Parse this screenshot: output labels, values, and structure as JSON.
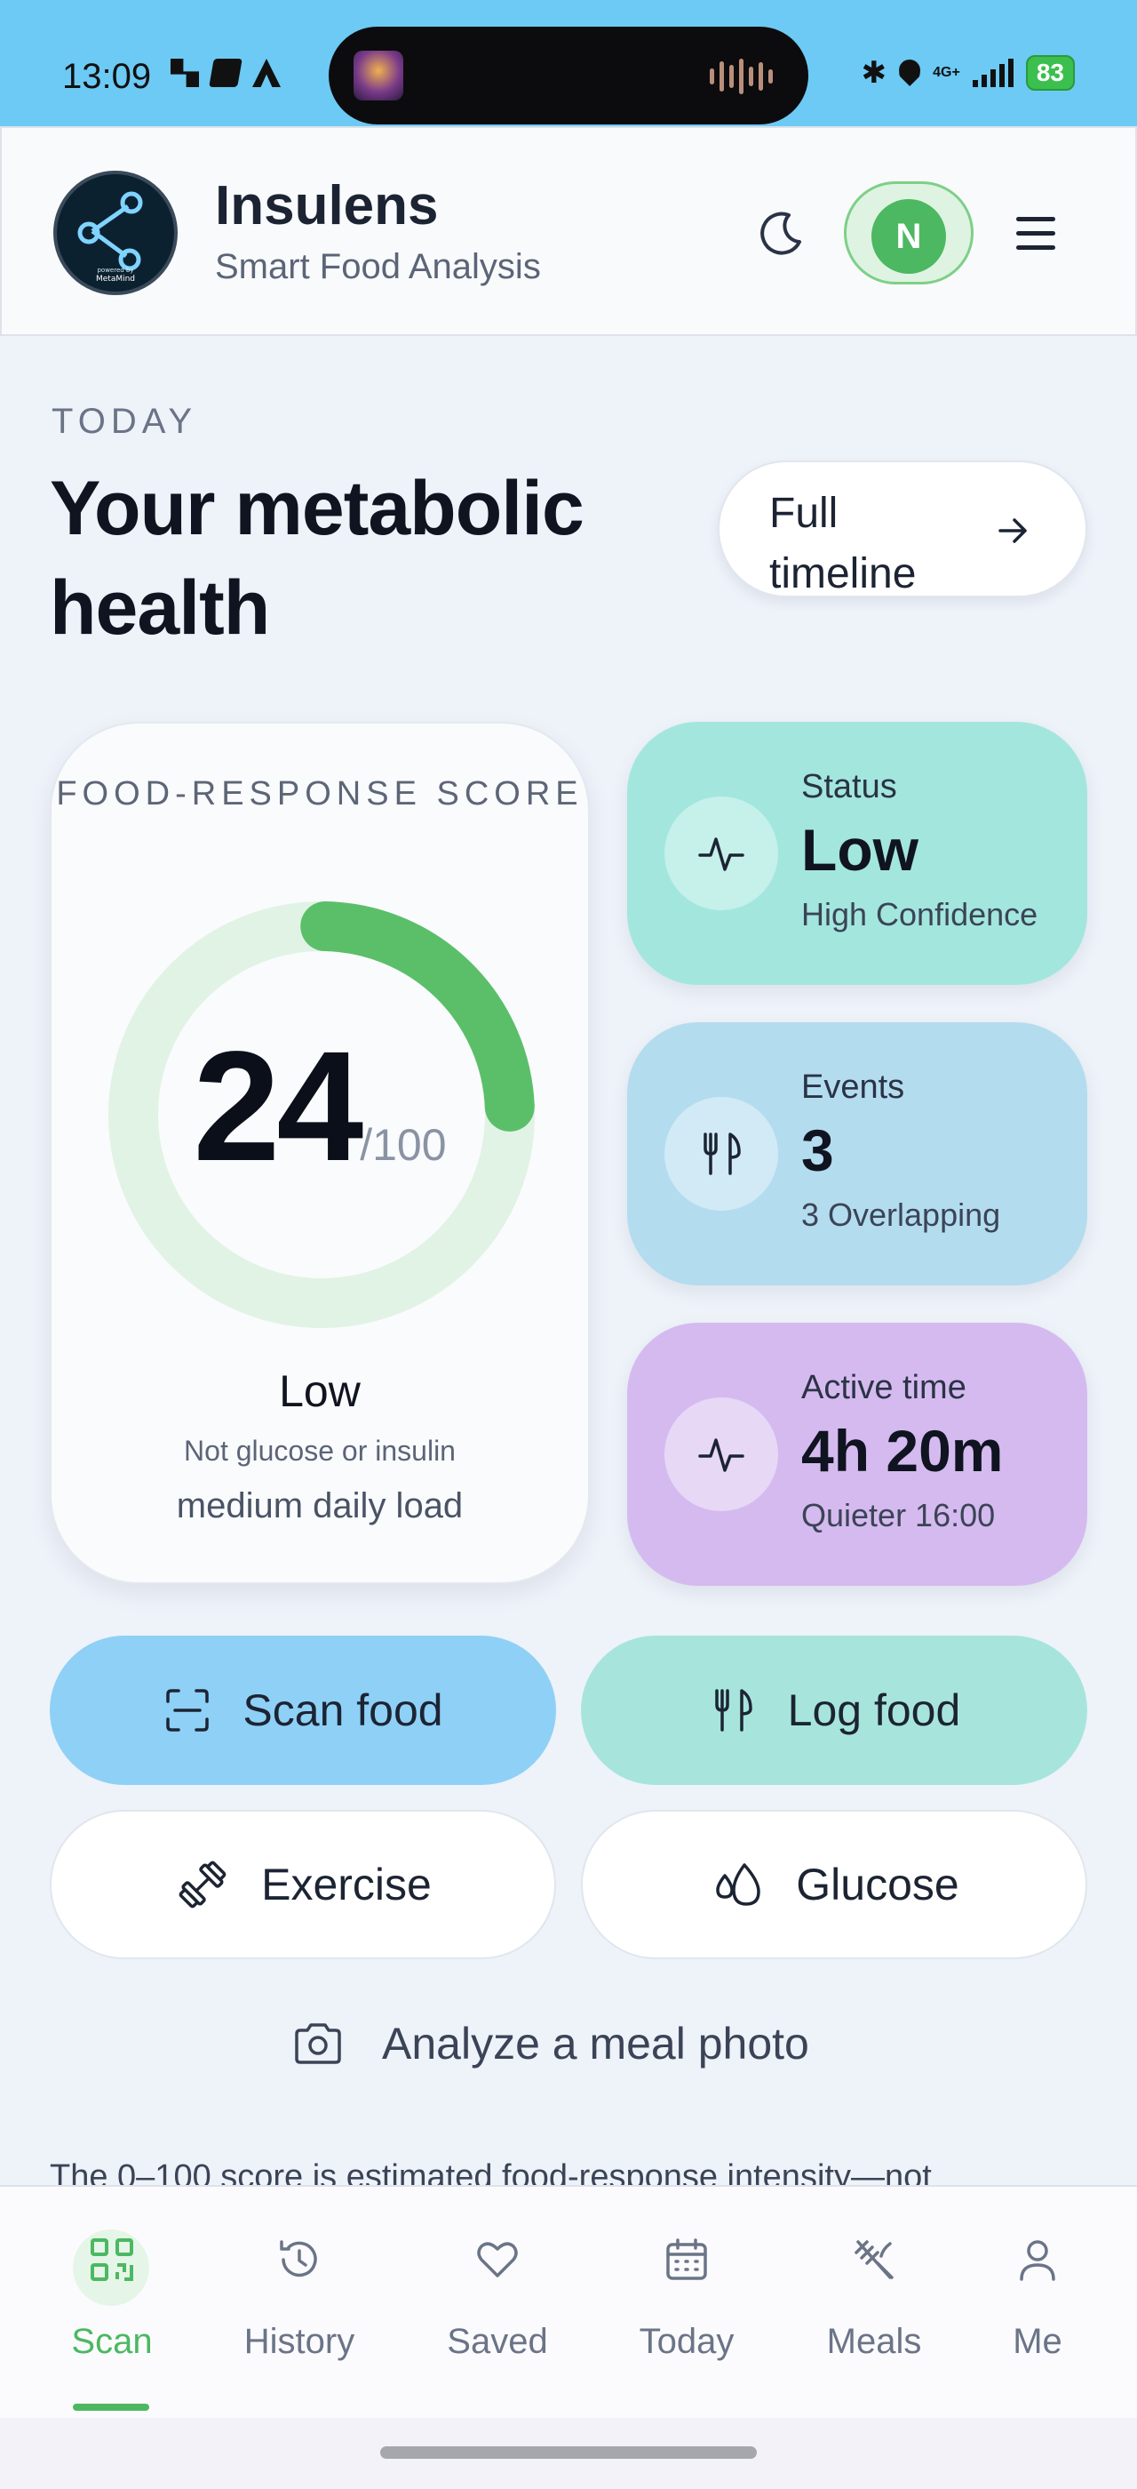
{
  "status_bar": {
    "time": "13:09",
    "battery": "83",
    "network": "4G+"
  },
  "header": {
    "app_name": "Insulens",
    "subtitle": "Smart Food Analysis",
    "logo_caption": "powered by",
    "logo_brand": "MetaMind",
    "avatar_initial": "N"
  },
  "main": {
    "kicker": "TODAY",
    "title": "Your metabolic health",
    "timeline_button": "Full timeline",
    "score_card": {
      "label": "FOOD-RESPONSE SCORE",
      "score": "24",
      "max": "/100",
      "score_fraction": 0.24,
      "status": "Low",
      "note": "Not glucose or insulin",
      "load": "medium daily load"
    },
    "stats": [
      {
        "title": "Status",
        "value": "Low",
        "detail": "High Confidence"
      },
      {
        "title": "Events",
        "value": "3",
        "detail": "3 Overlapping"
      },
      {
        "title": "Active time",
        "value": "4h 20m",
        "detail": "Quieter 16:00"
      }
    ],
    "actions": {
      "scan": "Scan food",
      "log": "Log food",
      "exercise": "Exercise",
      "glucose": "Glucose"
    },
    "analyze_photo": "Analyze a meal photo",
    "footnote": "The 0–100 score is estimated food-response intensity—not"
  },
  "bottom_nav": {
    "items": [
      {
        "label": "Scan",
        "icon": "qr-scan-icon",
        "active": true
      },
      {
        "label": "History",
        "icon": "history-icon",
        "active": false
      },
      {
        "label": "Saved",
        "icon": "heart-icon",
        "active": false
      },
      {
        "label": "Today",
        "icon": "calendar-icon",
        "active": false
      },
      {
        "label": "Meals",
        "icon": "meals-icon",
        "active": false
      },
      {
        "label": "Me",
        "icon": "person-icon",
        "active": false
      }
    ]
  },
  "colors": {
    "status_bar": "#6ccaf5",
    "accent_green": "#4cb862",
    "status_card": "#a3e6de",
    "events_card": "#b3dcef",
    "active_card": "#d5baf0",
    "scan_button": "#8fd0f6",
    "log_button": "#a7e5dc"
  }
}
